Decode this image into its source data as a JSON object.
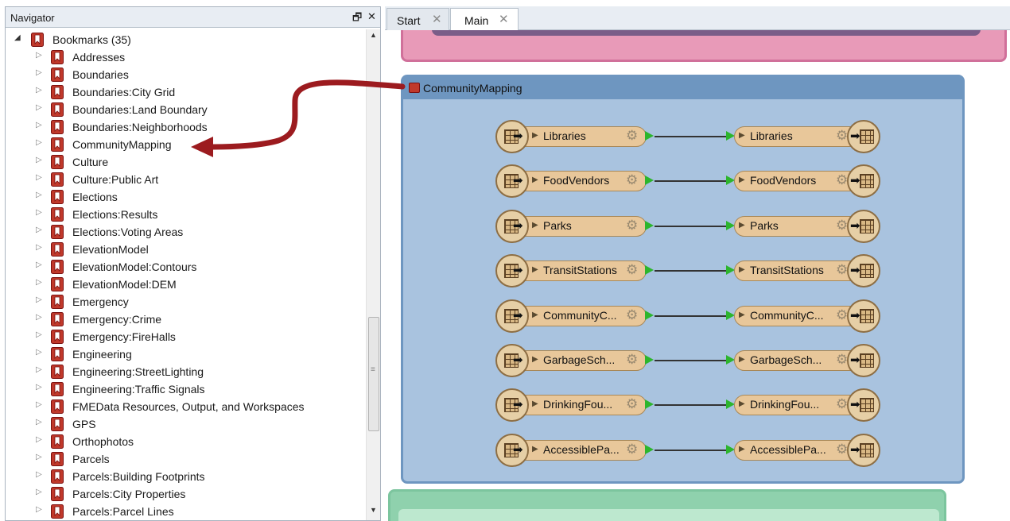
{
  "navigator": {
    "title": "Navigator",
    "pin_glyph": "🗗",
    "close_glyph": "✕",
    "root": {
      "label": "Bookmarks (35)",
      "expand_glyph": "◢"
    },
    "items": [
      "Addresses",
      "Boundaries",
      "Boundaries:City Grid",
      "Boundaries:Land Boundary",
      "Boundaries:Neighborhoods",
      "CommunityMapping",
      "Culture",
      "Culture:Public Art",
      "Elections",
      "Elections:Results",
      "Elections:Voting Areas",
      "ElevationModel",
      "ElevationModel:Contours",
      "ElevationModel:DEM",
      "Emergency",
      "Emergency:Crime",
      "Emergency:FireHalls",
      "Engineering",
      "Engineering:StreetLighting",
      "Engineering:Traffic Signals",
      "FMEData Resources, Output, and Workspaces",
      "GPS",
      "Orthophotos",
      "Parcels",
      "Parcels:Building Footprints",
      "Parcels:City Properties",
      "Parcels:Parcel Lines"
    ],
    "collapsed_glyph": "▷",
    "scroll_up_glyph": "▲",
    "scroll_down_glyph": "▼",
    "scroll_grip_glyph": "≡"
  },
  "tabs": [
    {
      "label": "Start",
      "close": "✕",
      "active": false
    },
    {
      "label": "Main",
      "close": "✕",
      "active": true
    }
  ],
  "canvas": {
    "bookmark_title": "CommunityMapping",
    "readers": [
      "Libraries",
      "FoodVendors",
      "Parks",
      "TransitStations",
      "CommunityC...",
      "GarbageSch...",
      "DrinkingFou...",
      "AccessiblePa..."
    ],
    "writers": [
      "Libraries",
      "FoodVendors",
      "Parks",
      "TransitStations",
      "CommunityC...",
      "GarbageSch...",
      "DrinkingFou...",
      "AccessiblePa..."
    ],
    "gear_glyph": "⚙",
    "expand_glyph": "▶",
    "arrow_glyph": "➡"
  },
  "colors": {
    "bookmark_icon": "#c0392b",
    "annotation_arrow": "#9c1b1f",
    "port": "#2db52d",
    "pink_bookmark": "#e89ab8",
    "blue_bookmark": "#a9c3df",
    "green_bookmark": "#8fd1ad"
  }
}
